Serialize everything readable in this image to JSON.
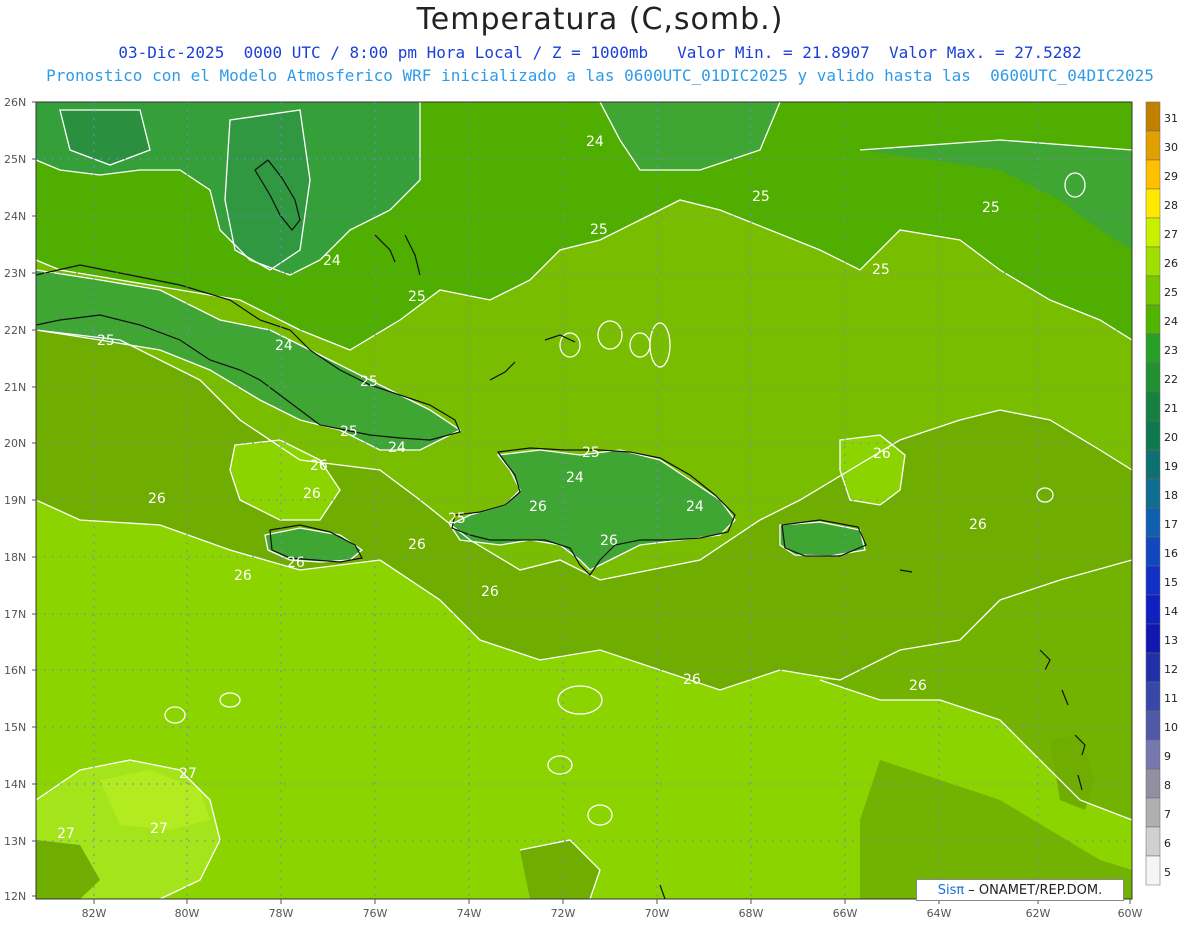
{
  "title": "Temperatura (C,somb.)",
  "subtitle_line1": "03-Dic-2025  0000 UTC / 8:00 pm Hora Local / Z = 1000mb   Valor Min. = 21.8907  Valor Max. = 27.5282",
  "subtitle_line2": "Pronostico con el Modelo Atmosferico WRF inicializado a las 0600UTC_01DIC2025 y valido hasta las  0600UTC_04DIC2025",
  "credit": {
    "brand": "Sisπ",
    "text": "– ONAMET/REP.DOM."
  },
  "lat_labels": [
    "26N",
    "25N",
    "24N",
    "23N",
    "22N",
    "21N",
    "20N",
    "19N",
    "18N",
    "17N",
    "16N",
    "15N",
    "14N",
    "13N",
    "12N"
  ],
  "lon_labels": [
    "82W",
    "80W",
    "78W",
    "76W",
    "74W",
    "72W",
    "70W",
    "68W",
    "66W",
    "64W",
    "62W",
    "60W"
  ],
  "colorbar": {
    "labels": [
      "31",
      "30",
      "29",
      "28",
      "27",
      "26",
      "25",
      "24",
      "23",
      "22",
      "21",
      "20",
      "19",
      "18",
      "17",
      "16",
      "15",
      "14",
      "13",
      "12",
      "11",
      "10",
      "9",
      "8",
      "7",
      "6",
      "5"
    ],
    "colors": [
      "#c08000",
      "#e0a000",
      "#ffc000",
      "#ffe800",
      "#c8f000",
      "#a0e000",
      "#78c800",
      "#50b400",
      "#28a028",
      "#209030",
      "#168040",
      "#107850",
      "#0e7070",
      "#106c90",
      "#1060b0",
      "#1048c0",
      "#1030c8",
      "#1020c0",
      "#1018b0",
      "#2030a8",
      "#3848a8",
      "#5058a8",
      "#7878b0",
      "#9090a0",
      "#b0b0b0",
      "#d0d0d0",
      "#f5f5f5"
    ]
  },
  "contour_labels": [
    {
      "text": "24"
    },
    {
      "text": "25"
    },
    {
      "text": "25"
    },
    {
      "text": "25"
    },
    {
      "text": "25"
    },
    {
      "text": "24"
    },
    {
      "text": "25"
    },
    {
      "text": "25"
    },
    {
      "text": "24"
    },
    {
      "text": "25"
    },
    {
      "text": "24"
    },
    {
      "text": "26"
    },
    {
      "text": "26"
    },
    {
      "text": "26"
    },
    {
      "text": "25"
    },
    {
      "text": "26"
    },
    {
      "text": "25"
    },
    {
      "text": "26"
    },
    {
      "text": "24"
    },
    {
      "text": "25"
    },
    {
      "text": "24"
    },
    {
      "text": "26"
    },
    {
      "text": "26"
    },
    {
      "text": "26"
    },
    {
      "text": "26"
    },
    {
      "text": "26"
    },
    {
      "text": "26"
    },
    {
      "text": "26"
    },
    {
      "text": "26"
    },
    {
      "text": "27"
    },
    {
      "text": "27"
    },
    {
      "text": "27"
    }
  ]
}
